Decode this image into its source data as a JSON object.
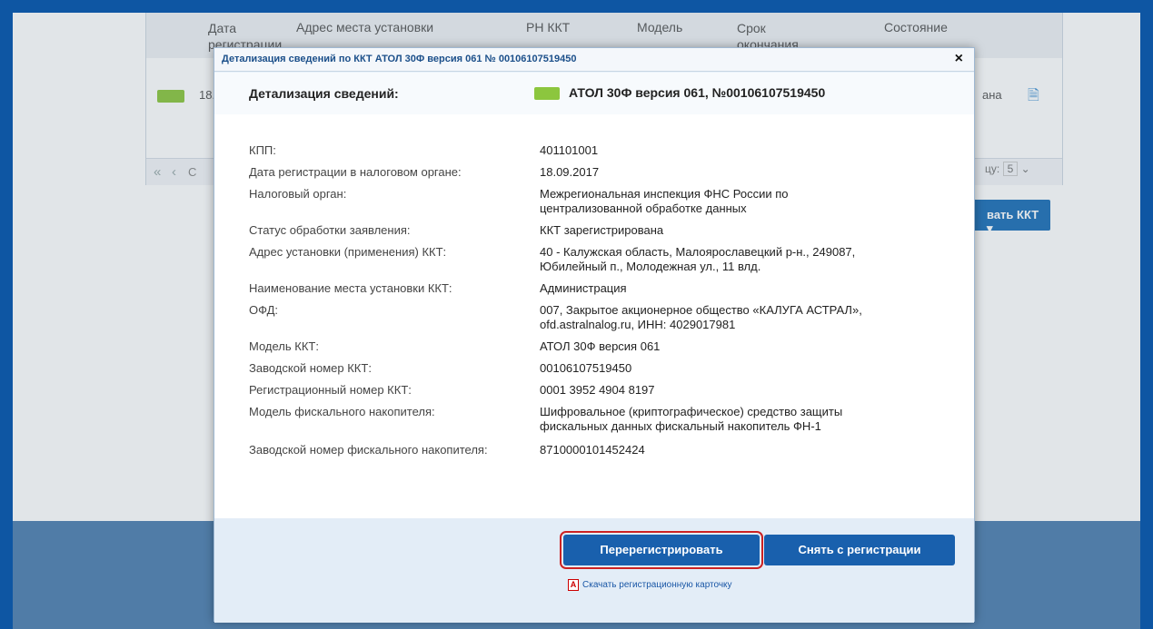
{
  "background": {
    "columns": [
      "Дата регистрации",
      "Адрес места установки",
      "РН ККТ",
      "Модель",
      "Срок окончания",
      "Состояние"
    ],
    "row_date": "18.",
    "row_state": "ана",
    "pager_fragment": "С",
    "per_page_label": "цу:",
    "per_page_value": "5",
    "action_button": "вать ККТ"
  },
  "dialog": {
    "title": "Детализация сведений по ККТ АТОЛ 30Ф версия 061 № 00106107519450",
    "close": "×",
    "header_label": "Детализация сведений:",
    "header_title": "АТОЛ 30Ф версия 061, №00106107519450",
    "status_color": "#8cc63e",
    "fields": [
      {
        "label": "КПП:",
        "value": "401101001"
      },
      {
        "label": "Дата регистрации в налоговом органе:",
        "value": "18.09.2017"
      },
      {
        "label": "Налоговый орган:",
        "value": "Межрегиональная инспекция ФНС России по централизованной обработке данных"
      },
      {
        "label": "Статус обработки заявления:",
        "value": "ККТ зарегистрирована"
      },
      {
        "label": "Адрес установки (применения) ККТ:",
        "value": "40 - Калужская область, Малоярославецкий р-н., 249087, Юбилейный п., Молодежная ул., 11 влд."
      },
      {
        "label": "Наименование места установки ККТ:",
        "value": "Администрация"
      },
      {
        "label": "ОФД:",
        "value": "007, Закрытое акционерное общество «КАЛУГА АСТРАЛ», ofd.astralnalog.ru, ИНН: 4029017981"
      },
      {
        "label": "Модель ККТ:",
        "value": "АТОЛ 30Ф версия 061"
      },
      {
        "label": "Заводской номер ККТ:",
        "value": "00106107519450"
      },
      {
        "label": "Регистрационный номер ККТ:",
        "value": "0001 3952 4904 8197"
      },
      {
        "label": "Модель фискального накопителя:",
        "value": "Шифровальное (криптографическое) средство защиты фискальных данных фискальный накопитель ФН-1"
      },
      {
        "label": "Заводской номер фискального накопителя:",
        "value": "8710000101452424"
      }
    ],
    "buttons": {
      "reregister": "Перерегистрировать",
      "deregister": "Снять с регистрации"
    },
    "download_link": "Скачать регистрационную карточку"
  }
}
